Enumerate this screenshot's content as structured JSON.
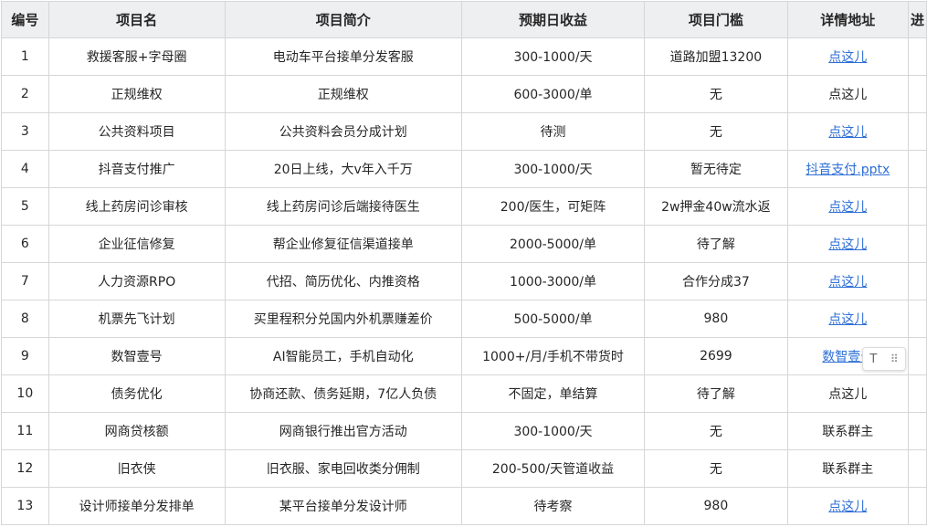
{
  "headers": [
    "编号",
    "项目名",
    "项目简介",
    "预期日收益",
    "项目门槛",
    "详情地址",
    "进"
  ],
  "rows": [
    {
      "id": "1",
      "name": "救援客服+字母圈",
      "intro": "电动车平台接单分发客服",
      "income": "300-1000/天",
      "threshold": "道路加盟13200",
      "link": "点这儿",
      "link_is_url": true
    },
    {
      "id": "2",
      "name": "正规维权",
      "intro": "正规维权",
      "income": "600-3000/单",
      "threshold": "无",
      "link": "点这儿",
      "link_is_url": false
    },
    {
      "id": "3",
      "name": "公共资料项目",
      "intro": "公共资料会员分成计划",
      "income": "待测",
      "threshold": "无",
      "link": "点这儿",
      "link_is_url": true
    },
    {
      "id": "4",
      "name": "抖音支付推广",
      "intro": "20日上线，大v年入千万",
      "income": "300-1000/天",
      "threshold": "暂无待定",
      "link": "抖音支付.pptx",
      "link_is_url": true
    },
    {
      "id": "5",
      "name": "线上药房问诊审核",
      "intro": "线上药房问诊后端接待医生",
      "income": "200/医生，可矩阵",
      "threshold": "2w押金40w流水返",
      "link": "点这儿",
      "link_is_url": true
    },
    {
      "id": "6",
      "name": "企业征信修复",
      "intro": "帮企业修复征信渠道接单",
      "income": "2000-5000/单",
      "threshold": "待了解",
      "link": "点这儿",
      "link_is_url": true
    },
    {
      "id": "7",
      "name": "人力资源RPO",
      "intro": "代招、简历优化、内推资格",
      "income": "1000-3000/单",
      "threshold": "合作分成37",
      "link": "点这儿",
      "link_is_url": true
    },
    {
      "id": "8",
      "name": "机票先飞计划",
      "intro": "买里程积分兑国内外机票赚差价",
      "income": "500-5000/单",
      "threshold": "980",
      "link": "点这儿",
      "link_is_url": true
    },
    {
      "id": "9",
      "name": "数智壹号",
      "intro": "AI智能员工，手机自动化",
      "income": "1000+/月/手机不带货时",
      "threshold": "2699",
      "link": "数智壹号",
      "link_is_url": true
    },
    {
      "id": "10",
      "name": "债务优化",
      "intro": "协商还款、债务延期，7亿人负债",
      "income": "不固定，单结算",
      "threshold": "待了解",
      "link": "点这儿",
      "link_is_url": false
    },
    {
      "id": "11",
      "name": "网商贷核额",
      "intro": "网商银行推出官方活动",
      "income": "300-1000/天",
      "threshold": "无",
      "link": "联系群主",
      "link_is_url": false
    },
    {
      "id": "12",
      "name": "旧衣侠",
      "intro": "旧衣服、家电回收类分佣制",
      "income": "200-500/天管道收益",
      "threshold": "无",
      "link": "联系群主",
      "link_is_url": false
    },
    {
      "id": "13",
      "name": "设计师接单分发排单",
      "intro": "某平台接单分发设计师",
      "income": "待考察",
      "threshold": "980",
      "link": "点这儿",
      "link_is_url": true
    }
  ],
  "toolbar": {
    "text_icon_glyph": "T",
    "drag_icon_glyph": "⠿"
  }
}
